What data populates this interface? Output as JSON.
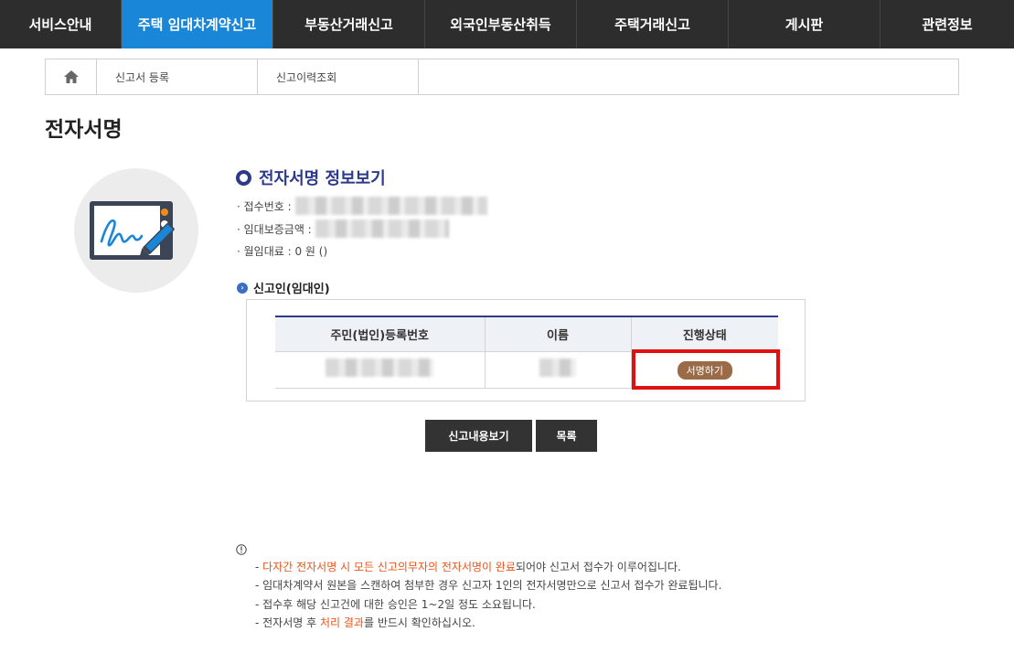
{
  "topnav": {
    "items": [
      {
        "label": "서비스안내",
        "active": false
      },
      {
        "label": "주택 임대차계약신고",
        "active": true
      },
      {
        "label": "부동산거래신고",
        "active": false
      },
      {
        "label": "외국인부동산취득",
        "active": false
      },
      {
        "label": "주택거래신고",
        "active": false
      },
      {
        "label": "게시판",
        "active": false
      },
      {
        "label": "관련정보",
        "active": false
      }
    ]
  },
  "subnav": {
    "home_icon": "home-icon",
    "items": [
      "신고서 등록",
      "신고이력조회"
    ]
  },
  "page": {
    "title": "전자서명"
  },
  "info": {
    "title": "전자서명 정보보기",
    "receipt_label": "· 접수번호 :",
    "deposit_label": "· 임대보증금액 :",
    "rent_label": "· 월임대료 : 0 원 ()"
  },
  "reporter": {
    "title": "신고인(임대인)",
    "headers": [
      "주민(법인)등록번호",
      "이름",
      "진행상태"
    ],
    "sign_button": "서명하기"
  },
  "buttons": {
    "view_report": "신고내용보기",
    "list": "목록"
  },
  "notes": {
    "icon": "info-icon",
    "line1_a": "- ",
    "line1_hl": "다자간 전자서명 시 모든 신고의무자의 전자서명이 완료",
    "line1_b": "되어야 신고서 접수가 이루어집니다.",
    "line2": "- 임대차계약서 원본을 스캔하여 첨부한 경우 신고자 1인의 전자서명만으로 신고서 접수가 완료됩니다.",
    "line3": "- 접수후 해당 신고건에 대한 승인은 1~2일 정도 소요됩니다.",
    "line4_a": "- 전자서명 후 ",
    "line4_hl": "처리 결과",
    "line4_b": "를 반드시 확인하십시오."
  },
  "colors": {
    "nav_bg": "#2d2d2d",
    "nav_active": "#1a86d8",
    "title_blue": "#2d3a8a",
    "highlight": "#e8541c",
    "sign_badge": "#9a6b46",
    "alert_red": "#e01010"
  }
}
